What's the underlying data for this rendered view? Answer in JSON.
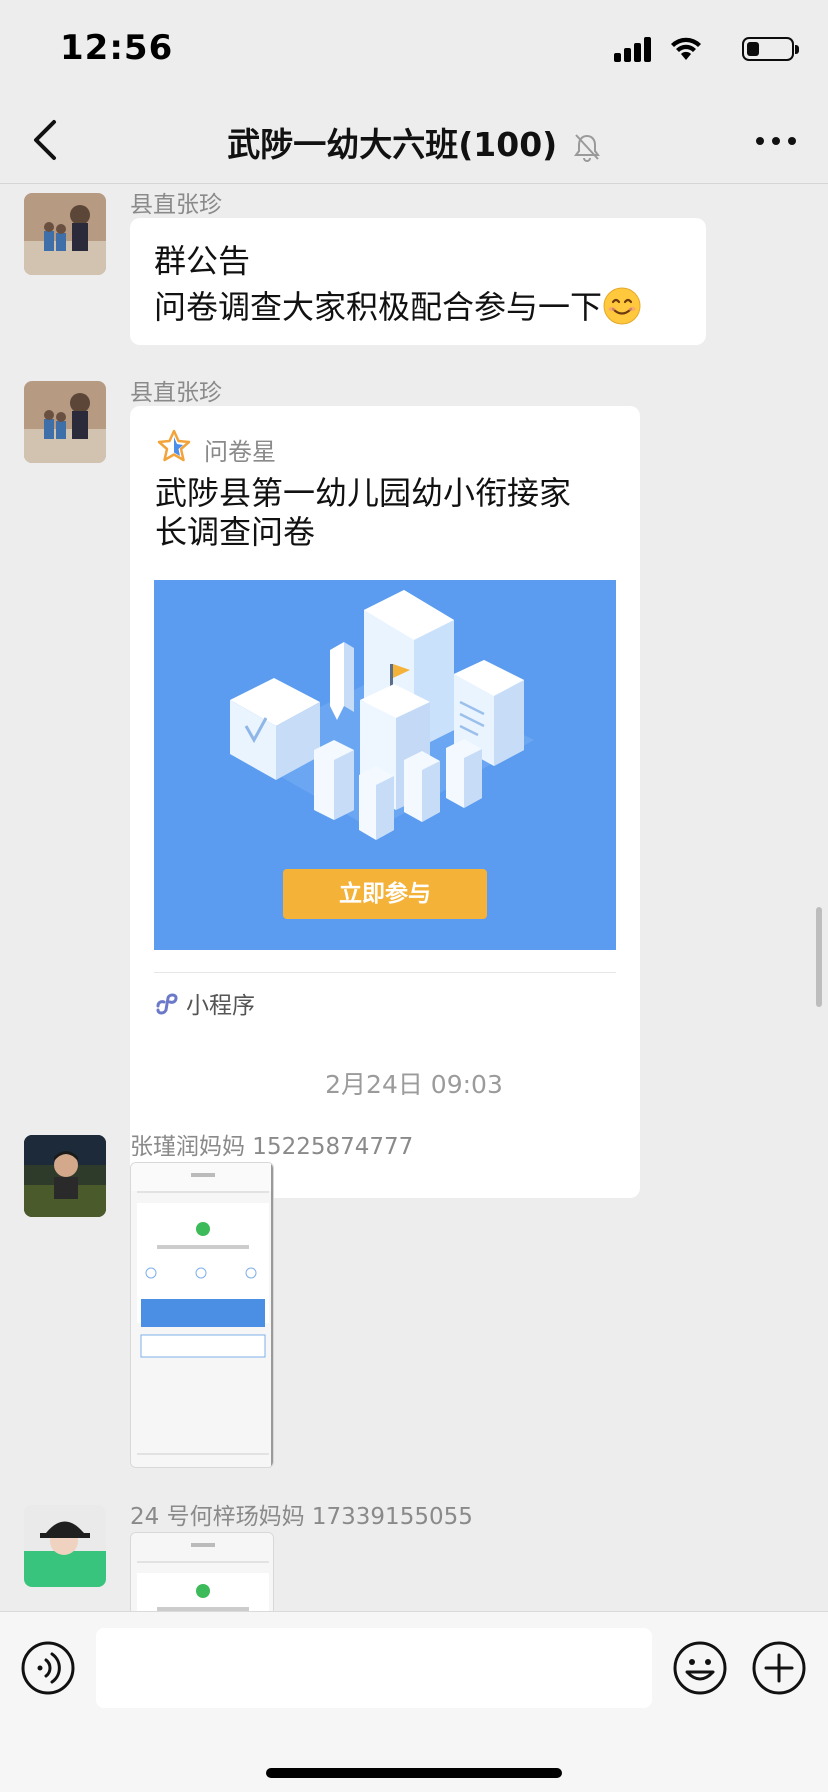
{
  "status_bar": {
    "time": "12:56"
  },
  "header": {
    "title": "武陟一幼大六班(100)",
    "back_icon": "chevron-left-icon",
    "mute_icon": "bell-muted-icon",
    "more_icon": "ellipsis-icon"
  },
  "messages": [
    {
      "sender": "县直张珍",
      "lines": [
        "群公告",
        "问卷调查大家积极配合参与一下"
      ],
      "emoji": "smiling-face-icon"
    },
    {
      "sender": "县直张珍",
      "card": {
        "source_label": "问卷星",
        "title": "武陟县第一幼儿园幼小衔接家长调查问卷",
        "cta_label": "立即参与",
        "footer_label": "小程序",
        "image_color": "#5b9cf0",
        "cta_color": "#f4b239"
      }
    },
    {
      "time_divider": "2月24日 09:03"
    },
    {
      "sender": "张瑾润妈妈 15225874777",
      "image_type": "screenshot-thumbnail"
    },
    {
      "sender": "24 号何梓玚妈妈 17339155055",
      "image_type": "screenshot-thumbnail"
    }
  ],
  "input_bar": {
    "placeholder": "",
    "voice_icon": "voice-icon",
    "emoji_icon": "emoji-icon",
    "plus_icon": "plus-icon"
  },
  "colors": {
    "background": "#ededed",
    "bubble": "#ffffff",
    "meta_text": "#8a8a8a"
  }
}
